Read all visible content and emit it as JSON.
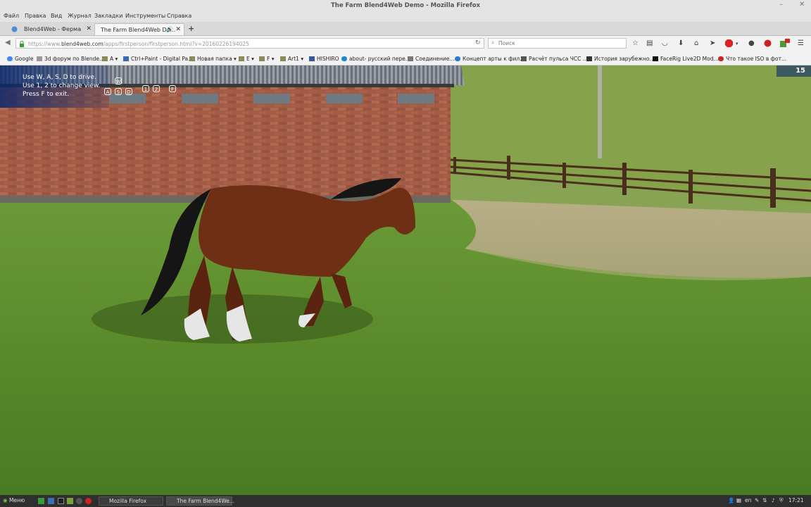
{
  "window": {
    "title": "The Farm Blend4Web Demo - Mozilla Firefox",
    "min": "–",
    "close": "✕"
  },
  "menu": [
    "Файл",
    "Правка",
    "Вид",
    "Журнал",
    "Закладки",
    "Инструменты",
    "Справка"
  ],
  "tabs": [
    {
      "label": "Blend4Web - Ферма"
    },
    {
      "label": "The Farm Blend4Web De..."
    }
  ],
  "urlbar": {
    "prefix": "https://www.",
    "host": "blend4web.com",
    "path": "/apps/firstperson/firstperson.html?v=20160226194025"
  },
  "search": {
    "placeholder": "Поиск"
  },
  "bookmarks": [
    "Google",
    "3d форум по Blende...",
    "A",
    "Ctrl+Paint - Digital Pa...",
    "Новая папка",
    "E",
    "F",
    "Art1",
    "HISHIRO",
    "about- русский пере...",
    "Соединение...",
    "Концепт арты к фил...",
    "Расчёт пульса ЧСС ...",
    "История зарубежно...",
    "FaceRig Live2D Mod...",
    "Что такое ISO в фот..."
  ],
  "hud": {
    "line1": "Use W, A, S, D to drive.",
    "line2": "Use 1, 2 to change view.",
    "line3": "Press F to exit.",
    "keys": {
      "w": "W",
      "a": "A",
      "s": "S",
      "d": "D",
      "one": "1",
      "two": "2",
      "f": "F"
    },
    "fps": "15"
  },
  "taskbar": {
    "menu": "Меню",
    "window1": "Mozilla Firefox",
    "window2": "The Farm Blend4We...",
    "lang": "en",
    "time": "17:21"
  },
  "colors": {
    "hud_bg": "#0a2a6e",
    "grass": "#5f8a2e",
    "brick": "#9a5a42",
    "horse": "#6e2f14"
  }
}
